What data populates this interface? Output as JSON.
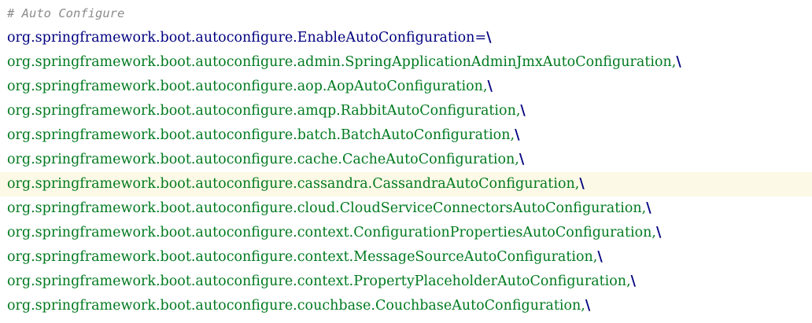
{
  "editor": {
    "comment": "# Auto Configure",
    "key_line": {
      "key": "org.springframework.boot.autoconfigure.EnableAutoConfiguration",
      "separator": "=",
      "continuation": "\\"
    },
    "entries": [
      {
        "value": "org.springframework.boot.autoconfigure.admin.SpringApplicationAdminJmxAutoConfiguration,",
        "continuation": "\\"
      },
      {
        "value": "org.springframework.boot.autoconfigure.aop.AopAutoConfiguration,",
        "continuation": "\\"
      },
      {
        "value": "org.springframework.boot.autoconfigure.amqp.RabbitAutoConfiguration,",
        "continuation": "\\"
      },
      {
        "value": "org.springframework.boot.autoconfigure.batch.BatchAutoConfiguration,",
        "continuation": "\\"
      },
      {
        "value": "org.springframework.boot.autoconfigure.cache.CacheAutoConfiguration,",
        "continuation": "\\"
      },
      {
        "value": "org.springframework.boot.autoconfigure.cassandra.CassandraAutoConfiguration,",
        "continuation": "\\"
      },
      {
        "value": "org.springframework.boot.autoconfigure.cloud.CloudServiceConnectorsAutoConfiguration,",
        "continuation": "\\"
      },
      {
        "value": "org.springframework.boot.autoconfigure.context.ConfigurationPropertiesAutoConfiguration,",
        "continuation": "\\"
      },
      {
        "value": "org.springframework.boot.autoconfigure.context.MessageSourceAutoConfiguration,",
        "continuation": "\\"
      },
      {
        "value": "org.springframework.boot.autoconfigure.context.PropertyPlaceholderAutoConfiguration,",
        "continuation": "\\"
      },
      {
        "value": "org.springframework.boot.autoconfigure.couchbase.CouchbaseAutoConfiguration,",
        "continuation": "\\"
      }
    ],
    "colors": {
      "comment": "#8c8c8c",
      "key": "#000080",
      "value": "#007a1f",
      "escape": "#000080",
      "current_line_highlight": "#fcf9e6"
    }
  }
}
